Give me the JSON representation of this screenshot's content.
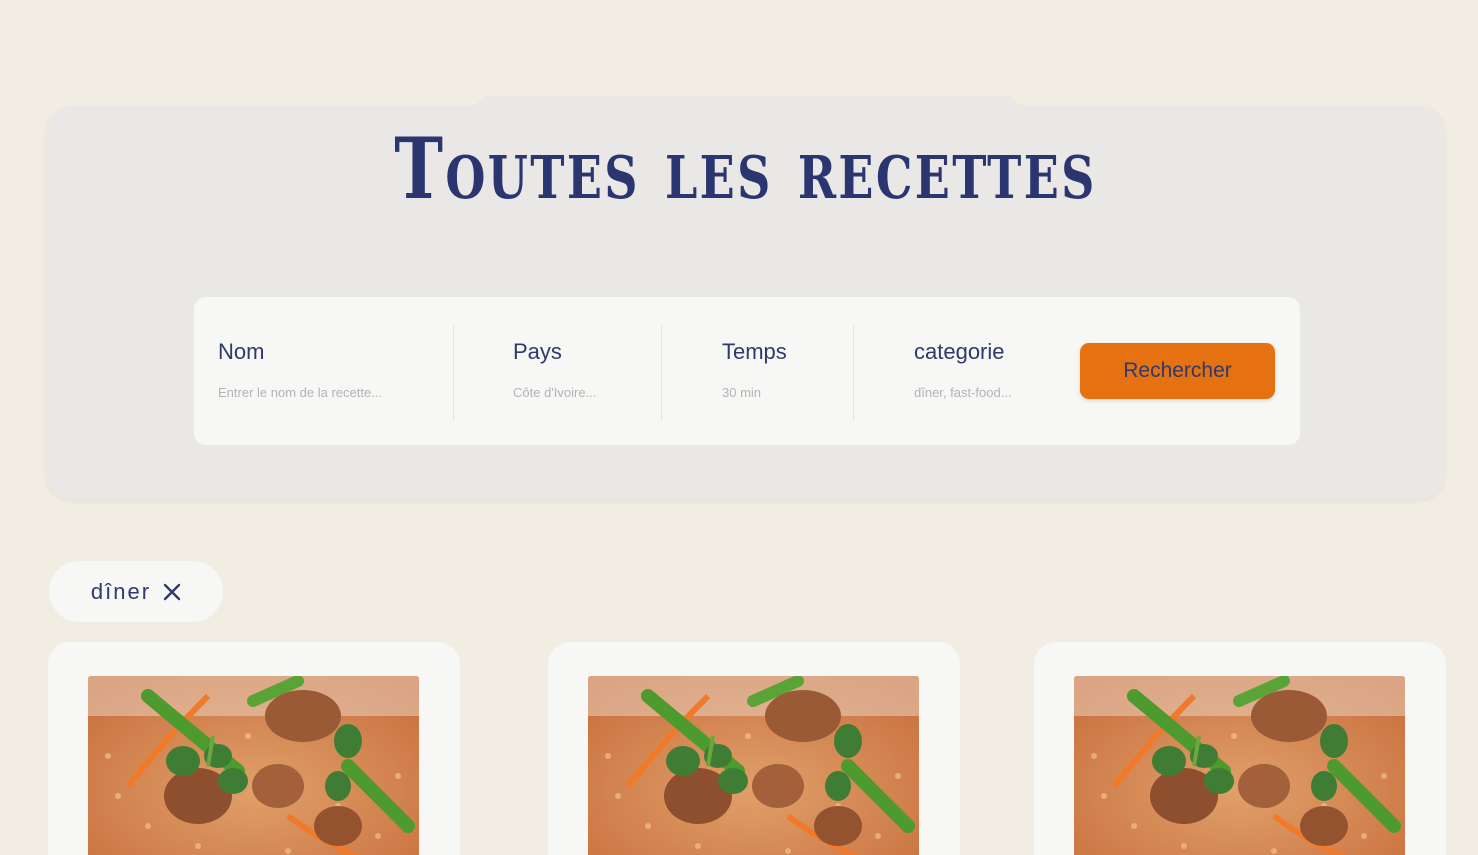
{
  "hero": {
    "title": "Toutes les recettes"
  },
  "search": {
    "fields": [
      {
        "label": "Nom",
        "placeholder": "Entrer le nom de la recette..."
      },
      {
        "label": "Pays",
        "placeholder": "Côte d'Ivoire..."
      },
      {
        "label": "Temps",
        "placeholder": "30 min"
      },
      {
        "label": "categorie",
        "placeholder": "dîner, fast-food..."
      }
    ],
    "button_label": "Rechercher"
  },
  "filters": {
    "active": [
      {
        "label": "dîner",
        "icon": "close-icon"
      }
    ]
  },
  "recipes": [
    {
      "image": "rice-with-meat-photo"
    },
    {
      "image": "rice-with-meat-photo"
    },
    {
      "image": "rice-with-meat-photo"
    }
  ],
  "colors": {
    "background": "#f1ede2",
    "panel": "#e9e8e6",
    "surface": "#f7f7f6",
    "accent": "#e67110",
    "text": "#2e3a6b"
  }
}
